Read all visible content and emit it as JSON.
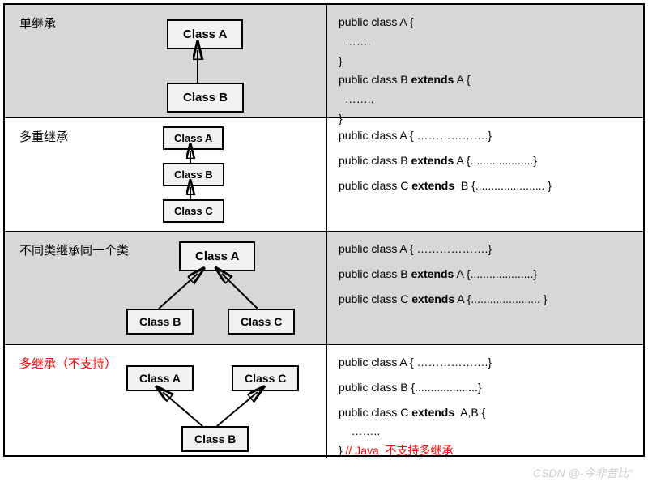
{
  "rows": [
    {
      "title": "单继承",
      "boxes": {
        "a": "Class A",
        "b": "Class B"
      },
      "code": [
        "public class A {",
        "  …….",
        "}",
        "public class B |extends| A {",
        "  ……..",
        "}"
      ]
    },
    {
      "title": "多重继承",
      "boxes": {
        "a": "Class A",
        "b": "Class B",
        "c": "Class C"
      },
      "code": [
        "public class A { ……………….}",
        "",
        "public class B |extends| A {....................}",
        "",
        "public class C |extends|  B {...................... }"
      ]
    },
    {
      "title": "不同类继承同一个类",
      "boxes": {
        "a": "Class A",
        "b": "Class B",
        "c": "Class C"
      },
      "code": [
        "public class A { ……………….}",
        "",
        "public class B |extends| A {....................}",
        "",
        "public class C |extends| A {...................... }"
      ]
    },
    {
      "title": "多继承（不支持）",
      "boxes": {
        "a": "Class A",
        "b": "Class B",
        "c": "Class C"
      },
      "code": [
        "public class A { ……………….}",
        "",
        "public class B {....................}",
        "",
        "public class C |extends|  A,B {",
        "    ……..",
        "} |red|// Java  不支持多继承"
      ]
    }
  ],
  "watermark": "CSDN @-今非昔比°"
}
